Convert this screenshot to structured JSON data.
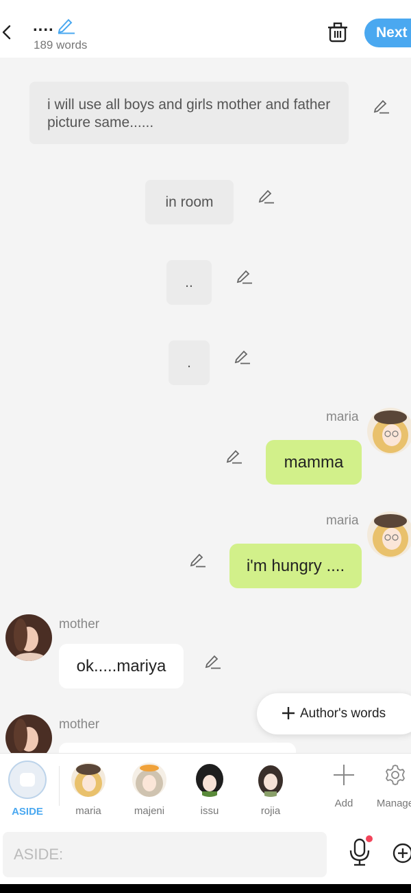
{
  "header": {
    "title": "....",
    "word_count": "189 words",
    "next_label": "Next"
  },
  "narrations": [
    {
      "text": "i will use all boys and girls mother and father picture same......"
    },
    {
      "text": "in room"
    },
    {
      "text": ".."
    },
    {
      "text": "."
    }
  ],
  "messages": [
    {
      "speaker": "maria",
      "text": "mamma"
    },
    {
      "speaker": "maria",
      "text": "i'm hungry ...."
    },
    {
      "speaker": "mother",
      "text": "ok.....mariya"
    },
    {
      "speaker": "mother",
      "text": ""
    }
  ],
  "authors_words_label": "Author's words",
  "characters": {
    "aside_label": "ASIDE",
    "items": [
      {
        "name": "maria"
      },
      {
        "name": "majeni"
      },
      {
        "name": "issu"
      },
      {
        "name": "rojia"
      }
    ],
    "add_label": "Add",
    "manage_label": "Manage"
  },
  "input": {
    "placeholder": "ASIDE:"
  },
  "colors": {
    "accent": "#4aa8f0",
    "aside_active": "#4aa8f0",
    "bubble_green": "#d2f08a",
    "mic_dot": "#f2445a"
  }
}
